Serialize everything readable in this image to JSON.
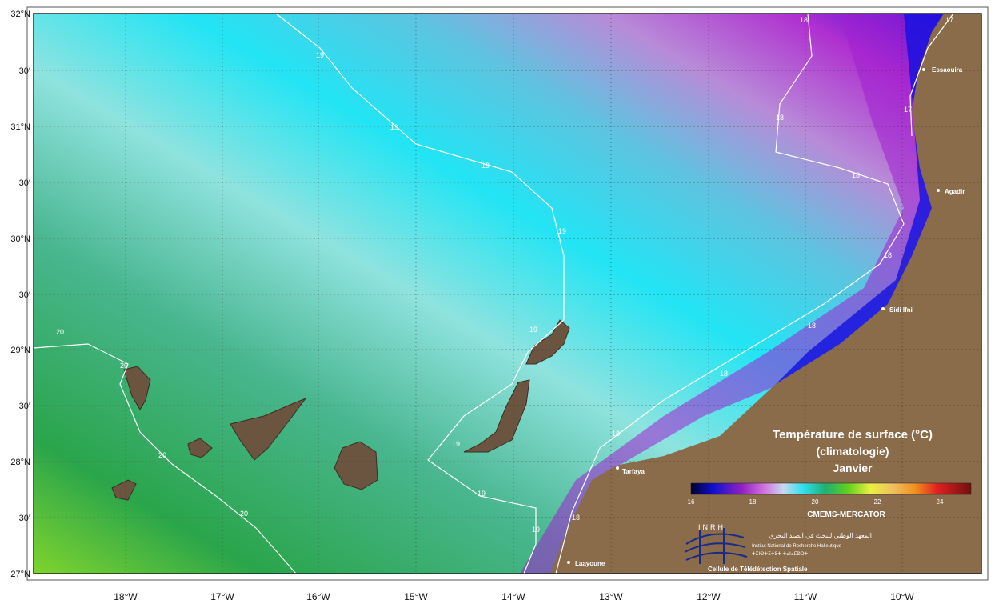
{
  "map": {
    "lat_labels": [
      "32°N",
      "30'",
      "31°N",
      "30'",
      "30°N",
      "30'",
      "29°N",
      "30'",
      "28°N",
      "30'",
      "27°N"
    ],
    "lon_labels": [
      "18°W",
      "17°W",
      "16°W",
      "15°W",
      "14°W",
      "13°W",
      "12°W",
      "11°W",
      "10°W"
    ],
    "cities": [
      {
        "name": "Essaouira"
      },
      {
        "name": "Agadir"
      },
      {
        "name": "Sidi Ifni"
      },
      {
        "name": "Tarfaya"
      },
      {
        "name": "Laayoune"
      }
    ],
    "isotherms": {
      "t17": "17",
      "t18": "18",
      "t19": "19",
      "t20": "20"
    }
  },
  "legend": {
    "title_line1": "Température de surface (°C)",
    "title_line2": "(climatologie)",
    "title_line3": "Janvier",
    "ticks": [
      "16",
      "18",
      "20",
      "22",
      "24"
    ],
    "source": "CMEMS-MERCATOR"
  },
  "logo": {
    "acronym": "INRH",
    "name_ar": "المعهد الوطني للبحث في الصيد البحري",
    "name_fr": "Institut National de Recherche Halieutique",
    "name_tz": "ⵜⵉⵏⵙⵜⵉⵜⵓⵜ ⵜⴰⵏⴰⵎⵓⵔⵜ",
    "unit": "Cellule de Télédétection Spatiale"
  },
  "colors": {
    "land": "#8a6b4a",
    "sst_16": "#00008b",
    "sst_18": "#c07ad8",
    "sst_19": "#3ed6ec",
    "sst_20": "#3fa86a"
  }
}
